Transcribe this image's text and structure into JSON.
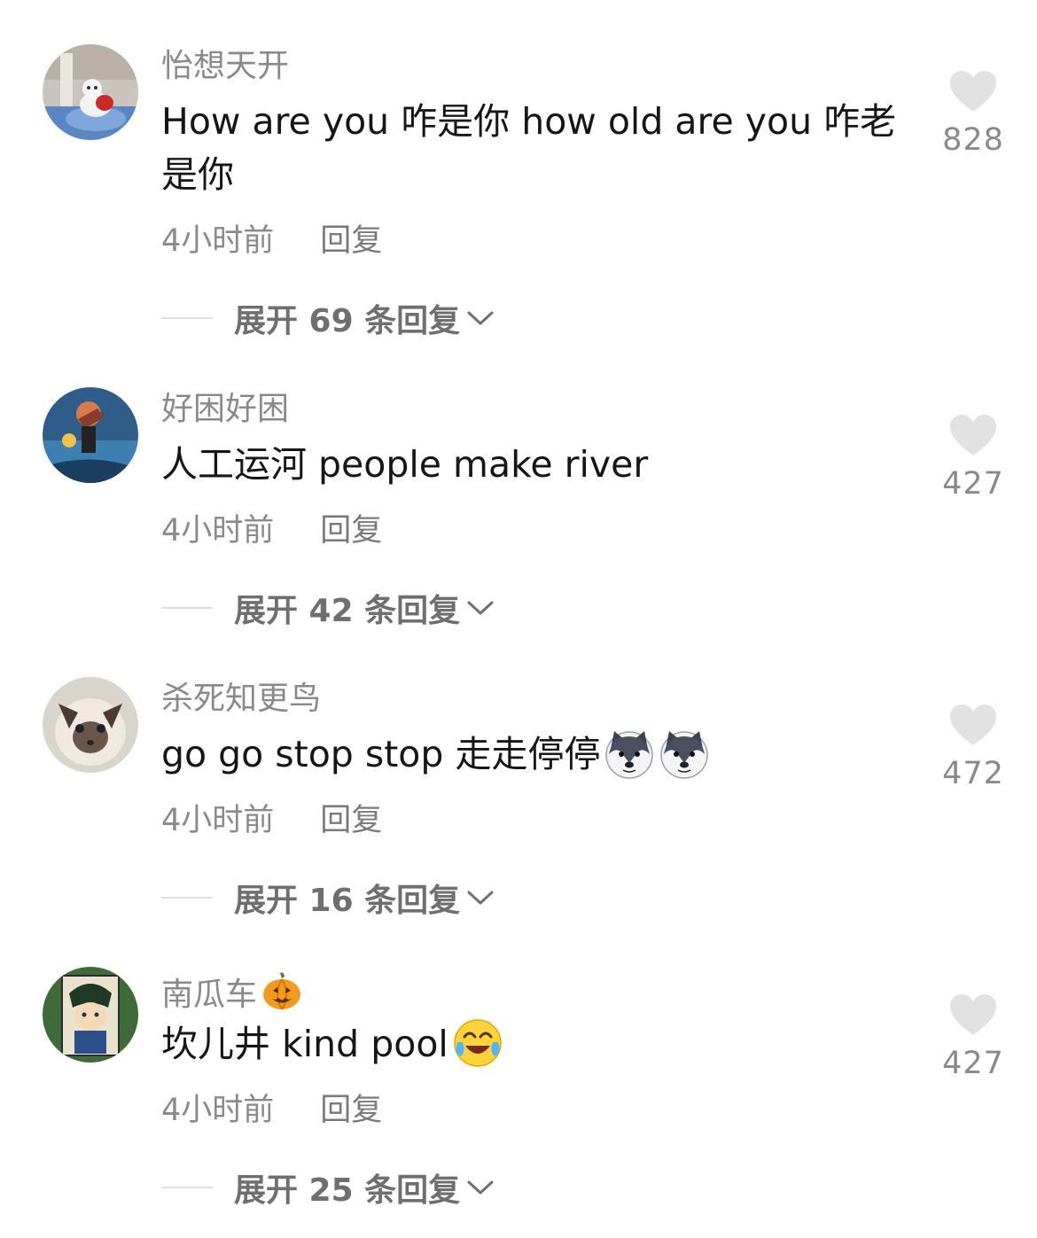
{
  "comments": [
    {
      "username": "怡想天开",
      "text": "How are you 咋是你 how old are you 咋老是你",
      "time": "4小时前",
      "reply_label": "回复",
      "expand_label": "展开 69 条回复",
      "likes": "828"
    },
    {
      "username": "好困好困",
      "text": "人工运河 people make river",
      "time": "4小时前",
      "reply_label": "回复",
      "expand_label": "展开 42 条回复",
      "likes": "427"
    },
    {
      "username": "杀死知更鸟",
      "text": "go go stop stop 走走停停",
      "text_emojis": [
        "husky-emoji",
        "husky-emoji"
      ],
      "time": "4小时前",
      "reply_label": "回复",
      "expand_label": "展开 16 条回复",
      "likes": "472"
    },
    {
      "username": "南瓜车",
      "username_emoji": "pumpkin-emoji",
      "text": "坎儿井 kind pool",
      "text_emojis": [
        "crying-laughing-emoji"
      ],
      "time": "4小时前",
      "reply_label": "回复",
      "expand_label": "展开 25 条回复",
      "likes": "427"
    }
  ],
  "icons": {
    "like": "heart-icon",
    "expand": "chevron-down-icon"
  },
  "colors": {
    "secondary_text": "#8a8a8a",
    "primary_text": "#161616",
    "heart": "#e2e2e2"
  }
}
